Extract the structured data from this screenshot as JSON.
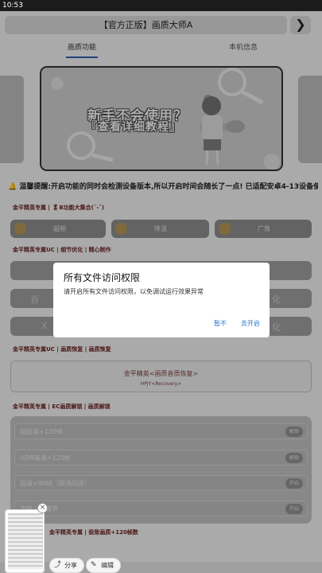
{
  "statusbar": {
    "time": "10:53"
  },
  "topbar": {
    "title": "【官方正版】画质大师A",
    "next": "❯"
  },
  "tabs": [
    {
      "label": "画质功能"
    },
    {
      "label": "本机信息"
    }
  ],
  "banner": {
    "title": "新手不会使用？",
    "subtitle": "『查看详细教程』"
  },
  "notice": {
    "text": "温馨提醒:开启功能的同时会检测设备版本,所以开启时间会随长了一点!   已适配安卓4-13设备使用!"
  },
  "sections": {
    "s1": "金平精英专属 | 🎖B功能大集合(ˆ-ˆ)",
    "s2": "金平精英专属UC | 细节优化 | 精心制作",
    "s3": "金平精英专属UC | 画质恢复 | 画质恢复",
    "s4": "金平精英专属 | EC画质解锁 | 画质解锁",
    "s5": "金平精英专属 | 极致画质+120帧数"
  },
  "pills": [
    {
      "label": "超频"
    },
    {
      "label": "降温"
    },
    {
      "label": "广角"
    }
  ],
  "ghosts": {
    "left1": "百",
    "right1": "化",
    "left2": "X",
    "right2": "化"
  },
  "recover": {
    "title": "金平精英<画质音质恢复>",
    "subtitle": "HPJY<Recovery>"
  },
  "rows": [
    {
      "label": "超级清+120帧",
      "btn": "解锁"
    },
    {
      "label": "HDR高清+120帧",
      "btn": "解锁"
    },
    {
      "label": "超清+90帧（取消闪退）",
      "btn": "开启"
    },
    {
      "label": "流畅 / 超清节",
      "btn": "开启"
    }
  ],
  "dialog": {
    "title": "所有文件访问权限",
    "message": "请开启所有文件访问权限，以免调试运行效果异常",
    "cancel": "暂不",
    "confirm": "去开启"
  },
  "screenshot_actions": {
    "share": "分享",
    "edit": "编辑",
    "close": "×"
  }
}
